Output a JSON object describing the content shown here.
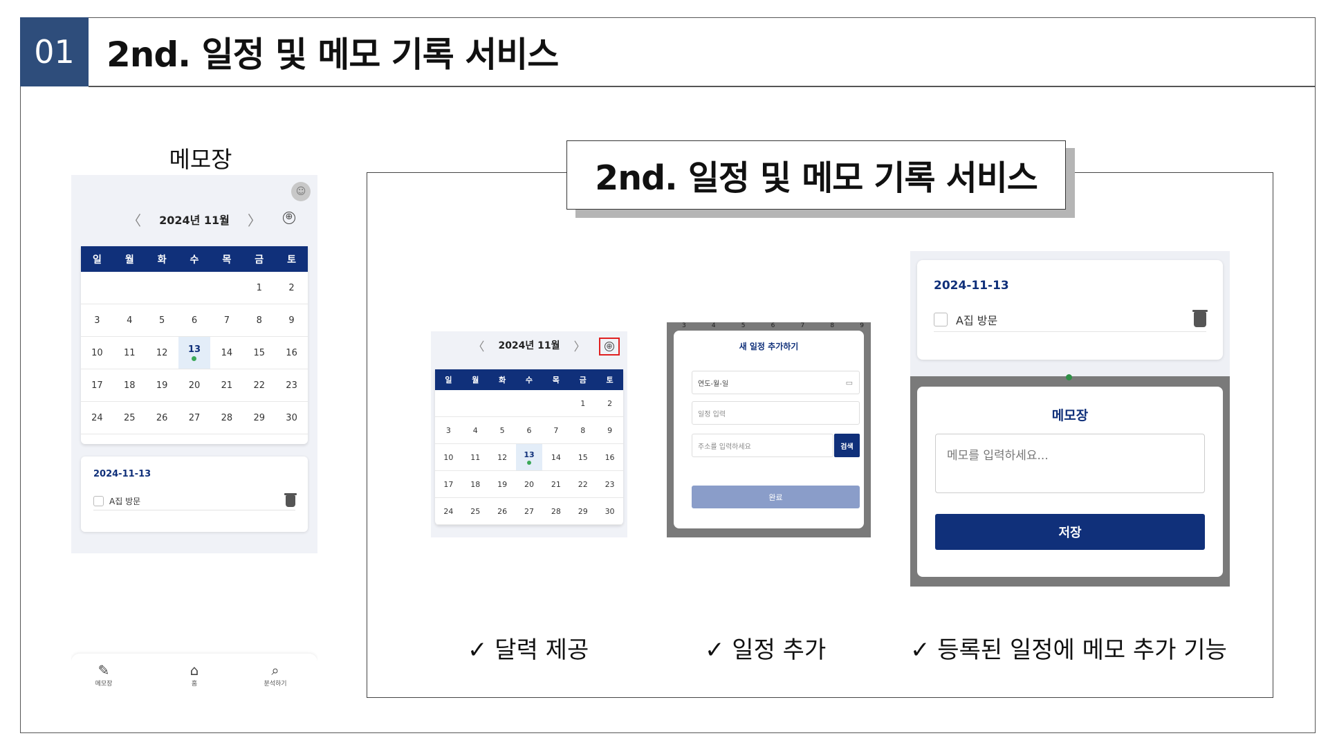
{
  "header": {
    "number": "01",
    "title": "2nd. 일정 및 메모 기록 서비스"
  },
  "phone": {
    "caption": "메모장",
    "calendar": {
      "prev": "〈",
      "next": "〉",
      "month_label": "2024년 11월",
      "add_icon": "⊕",
      "weekdays": [
        "일",
        "월",
        "화",
        "수",
        "목",
        "금",
        "토"
      ],
      "weeks": [
        [
          "",
          "",
          "",
          "",
          "",
          "1",
          "2"
        ],
        [
          "3",
          "4",
          "5",
          "6",
          "7",
          "8",
          "9"
        ],
        [
          "10",
          "11",
          "12",
          "13",
          "14",
          "15",
          "16"
        ],
        [
          "17",
          "18",
          "19",
          "20",
          "21",
          "22",
          "23"
        ],
        [
          "24",
          "25",
          "26",
          "27",
          "28",
          "29",
          "30"
        ]
      ],
      "today": "13"
    },
    "memo": {
      "date": "2024-11-13",
      "item": "A집 방문"
    },
    "nav": [
      {
        "label": "메모장",
        "icon": "memo-icon"
      },
      {
        "label": "홈",
        "icon": "home-icon"
      },
      {
        "label": "분석하기",
        "icon": "analyze-icon"
      }
    ]
  },
  "panel": {
    "title": "2nd. 일정 및 메모 기록 서비스"
  },
  "schedule_modal": {
    "day_numbers": [
      "3",
      "4",
      "5",
      "6",
      "7",
      "8",
      "9"
    ],
    "title": "새 일정 추가하기",
    "date_placeholder": "연도-월-일",
    "schedule_placeholder": "일정 입력",
    "address_placeholder": "주소를 입력하세요",
    "search_label": "검색",
    "done_label": "완료"
  },
  "memo_shot": {
    "date": "2024-11-13",
    "item": "A집 방문",
    "modal_title": "메모장",
    "placeholder": "메모를 입력하세요...",
    "save_label": "저장"
  },
  "captions": {
    "calendar": "✓ 달력 제공",
    "add": "✓ 일정 추가",
    "memo": "✓ 등록된 일정에 메모 추가 기능"
  },
  "colors": {
    "badge": "#2e4d7b",
    "navy": "#10307a",
    "dot": "#3aa857",
    "highlight": "#e02020"
  }
}
